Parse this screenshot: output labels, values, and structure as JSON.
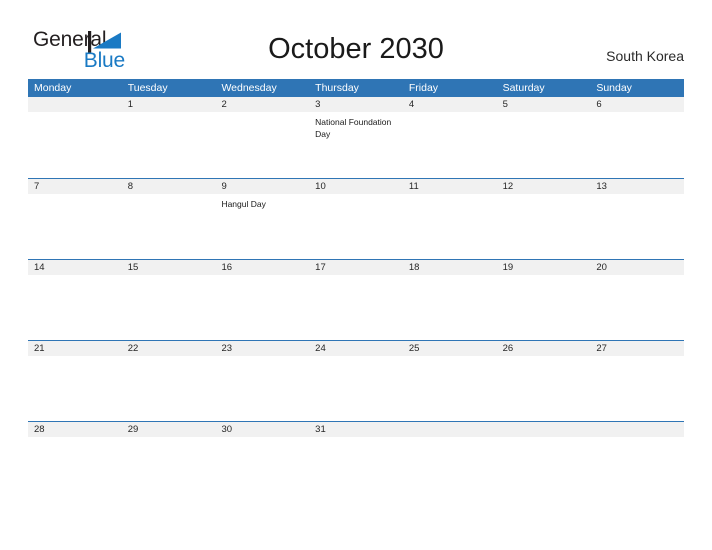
{
  "branding": {
    "name_part1": "General",
    "name_part2": "Blue",
    "flag_color": "#1a7ac4",
    "text_color": "#231f20"
  },
  "header": {
    "title": "October 2030",
    "region": "South Korea",
    "accent_color": "#2f75b5",
    "band_color": "#f1f1f1"
  },
  "calendar": {
    "weekdays": [
      "Monday",
      "Tuesday",
      "Wednesday",
      "Thursday",
      "Friday",
      "Saturday",
      "Sunday"
    ],
    "weeks": [
      [
        {
          "day": ""
        },
        {
          "day": "1"
        },
        {
          "day": "2"
        },
        {
          "day": "3",
          "event": "National Foundation Day"
        },
        {
          "day": "4"
        },
        {
          "day": "5"
        },
        {
          "day": "6"
        }
      ],
      [
        {
          "day": "7"
        },
        {
          "day": "8"
        },
        {
          "day": "9",
          "event": "Hangul Day"
        },
        {
          "day": "10"
        },
        {
          "day": "11"
        },
        {
          "day": "12"
        },
        {
          "day": "13"
        }
      ],
      [
        {
          "day": "14"
        },
        {
          "day": "15"
        },
        {
          "day": "16"
        },
        {
          "day": "17"
        },
        {
          "day": "18"
        },
        {
          "day": "19"
        },
        {
          "day": "20"
        }
      ],
      [
        {
          "day": "21"
        },
        {
          "day": "22"
        },
        {
          "day": "23"
        },
        {
          "day": "24"
        },
        {
          "day": "25"
        },
        {
          "day": "26"
        },
        {
          "day": "27"
        }
      ],
      [
        {
          "day": "28"
        },
        {
          "day": "29"
        },
        {
          "day": "30"
        },
        {
          "day": "31"
        },
        {
          "day": ""
        },
        {
          "day": ""
        },
        {
          "day": ""
        }
      ]
    ]
  }
}
